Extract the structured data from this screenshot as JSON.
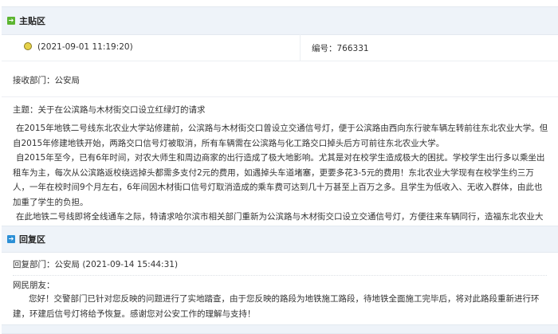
{
  "main_section": {
    "title": "主贴区",
    "timestamp": "(2021-09-01 11:19:20)",
    "number_label": "编号：766331",
    "department": "接收部门：公安局",
    "subject": "主题：关于在公滨路与木材街交口设立红绿灯的请求",
    "paragraphs": [
      "在2015年地铁二号线东北农业大学站修建前，公滨路与木材街交口曾设立交通信号灯，便于公滨路由西向东行驶车辆左转前往东北农业大学。但自2015年修建地铁开始，两路交口信号灯被取消，所有车辆需在公滨路与化工路交口掉头后方可前往东北农业大学。",
      "自2015年至今，已有6年时间，对农大师生和周边商家的出行造成了极大地影响。尤其是对在校学生造成极大的困扰。学校学生出行多以乘坐出租车为主，每次从公滨路返校绕远掉头都需多支付2元的费用，如遇掉头车道堵塞，更要多花3-5元的费用！东北农业大学现有在校学生约三万人，一年在校时间9个月左右，6年间因木材街口信号灯取消造成的乘车费可达到几十万甚至上百万之多。且学生为低收入、无收入群体，由此也加重了学生的负担。",
      "在此地铁二号线即将全线通车之际，特请求哈尔滨市相关部门重新为公滨路与木材街交口设立交通信号灯，方便往来车辆同行，造福东北农业大学周边的师生、住户、商户等。谢谢！"
    ]
  },
  "reply_section": {
    "title": "回复区",
    "department_line": "回复部门：公安局 (2021-09-14 15:44:31)",
    "greeting": "网民朋友：",
    "body": "您好！交警部门已针对您反映的问题进行了实地踏查，由于您反映的路段为地铁施工路段，待地铁全面施工完毕后，将对此路段重新进行环建，环建后信号灯将给予恢复。感谢您对公安工作的理解与支持！"
  },
  "colors": {
    "band": "#eef3f9",
    "main_icon": "#5cb531",
    "reply_icon": "#2b8fd6"
  }
}
